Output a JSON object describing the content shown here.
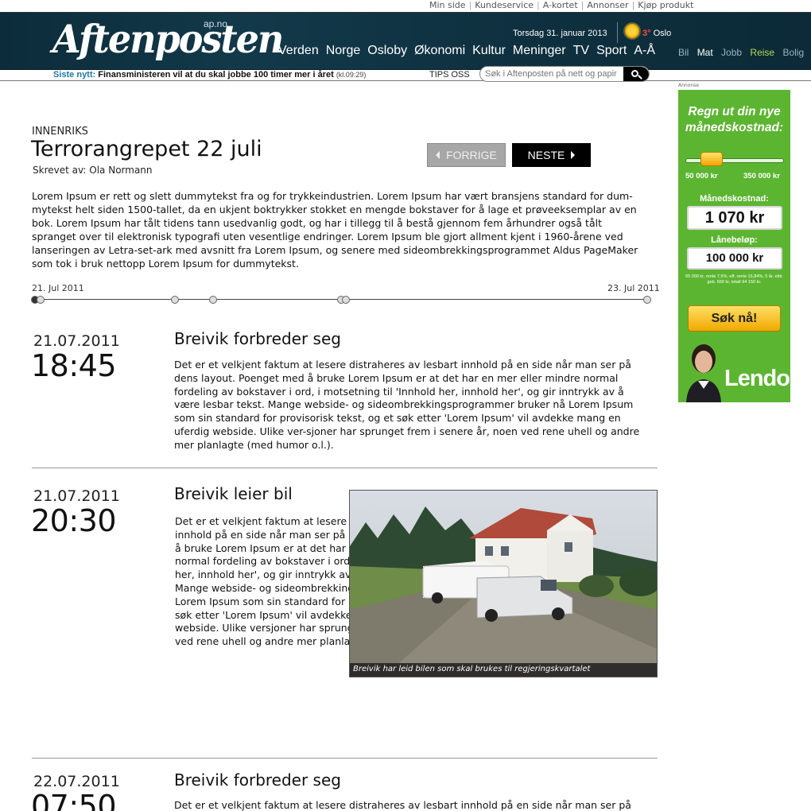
{
  "utility_links": [
    "Min side",
    "Kundeservice",
    "A-kortet",
    "Annonser",
    "Kjøp produkt"
  ],
  "header": {
    "logo": "Aftenposten",
    "logo_domain": "ap.no",
    "date": "Torsdag 31. januar 2013",
    "weather": {
      "temp": "3°",
      "city": "Oslo",
      "icon": "sun-icon"
    },
    "nav": [
      "Verden",
      "Norge",
      "Osloby",
      "Økonomi",
      "Kultur",
      "Meninger",
      "TV",
      "Sport",
      "A-Å"
    ],
    "subnav": [
      "Bil",
      "Mat",
      "Jobb",
      "Reise",
      "Bolig"
    ]
  },
  "newsbar": {
    "label": "Siste nytt:",
    "headline": "Finansministeren vil at du skal jobbe 100 timer mer i året",
    "time": "(kl.09:29)",
    "tips": "TIPS OSS",
    "search_placeholder": "Søk i Aftenposten på nett og papir"
  },
  "article": {
    "kicker": "INNENRIKS",
    "title": "Terrorangrepet 22 juli",
    "byline": "Skrevet av: Ola Normann",
    "prev_label": "FORRIGE",
    "next_label": "NESTE",
    "intro": "Lorem Ipsum er rett og slett dummytekst fra og for trykkeindustrien. Lorem Ipsum har vært bransjens standard for dum-mytekst helt siden 1500-tallet, da en ukjent boktrykker stokket en mengde bokstaver for å lage et prøveeksemplar av en bok. Lorem Ipsum har tålt tidens tann usedvanlig godt, og har i tillegg til å bestå gjennom fem århundrer også tålt spranget over til elektronisk typografi uten vesentlige endringer. Lorem Ipsum ble gjort allment kjent i 1960-årene ved lanseringen av Letra-set-ark med avsnitt fra Lorem Ipsum, og senere med sideombrekkingsprogrammet Aldus PageMaker som tok i bruk nettopp Lorem Ipsum for dummytekst."
  },
  "timeline": {
    "start": "21. Jul 2011",
    "end": "23. Jul 2011"
  },
  "entries": [
    {
      "date": "21.07.2011",
      "time": "18:45",
      "title": "Breivik forbreder seg",
      "body": "Det er et velkjent faktum at lesere distraheres av lesbart innhold på en side når man ser på dens layout. Poenget med å bruke Lorem Ipsum er at det har en mer eller mindre normal fordeling av bokstaver i ord, i motsetning til 'Innhold her, innhold her', og gir inntrykk av å være lesbar tekst. Mange webside- og sideombrekkingsprogrammer bruker nå Lorem Ipsum som sin standard for provisorisk tekst, og et søk etter 'Lorem Ipsum' vil avdekke mang en uferdig webside. Ulike ver-sjoner har sprunget frem i senere år, noen ved rene uhell og andre mer planlagte (med humor o.l.)."
    },
    {
      "date": "21.07.2011",
      "time": "20:30",
      "title": "Breivik leier bil",
      "body": "Det er et velkjent faktum at lesere distraheres av lesbart innhold på en side når man ser på dens layout. Poenget med å bruke Lorem Ipsum er at det har en mer eller mindre normal fordeling av  bokstaver i ord, i motsetning til 'Innhold her, innhold her', og gir inntrykk av å være lesbar tekst.  Mange webside- og sideombrekkingsprogrammer bruker nå Lorem Ipsum som sin standard for provisorisk tekst, og et søk etter 'Lorem Ipsum' vil avdekke mang en uferdig webside. Ulike versjoner har sprunget frem i senere år, noen ved rene uhell og andre mer planlagte (med humor o.l.).",
      "image_caption": "Breivik har leid bilen som skal brukes til regjeringskvartalet"
    },
    {
      "date": "22.07.2011",
      "time": "07:50",
      "title": "Breivik forbreder seg",
      "body": "Det er et velkjent faktum at lesere distraheres av lesbart innhold på en side når man ser på dens layout."
    }
  ],
  "ad": {
    "label": "Annonse",
    "headline_1": "Regn ut din nye",
    "headline_2": "månedskostnad:",
    "slider_value": 0.2,
    "min": "50 000 kr",
    "max": "350 000 kr",
    "monthly_label": "Månedskostnad:",
    "monthly_value": "1 070 kr",
    "loan_label": "Lånebeløp:",
    "loan_value": "100 000 kr",
    "fine_print": "65 000 kr, rente 7,9%, eff. rente 16,84%, 5 år, etbl. geb. 660 kr, totalt 94 150 kr.",
    "cta": "Søk nå!",
    "brand": "Lendo"
  }
}
